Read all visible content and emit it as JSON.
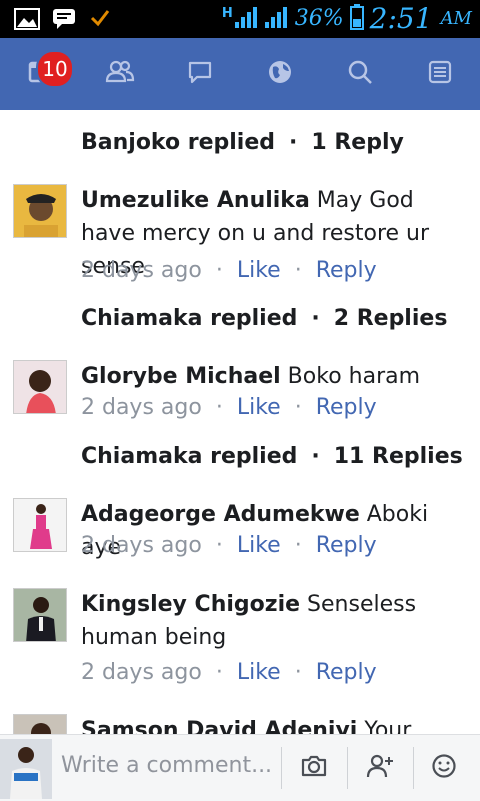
{
  "status_bar": {
    "battery_percent": "36%",
    "time": "2:51",
    "ampm": "AM",
    "network": "H"
  },
  "nav": {
    "notifications_badge": "10",
    "items": [
      "news-feed",
      "friends",
      "messages",
      "notifications",
      "search",
      "menu"
    ]
  },
  "feed": {
    "threads": [
      {
        "replied": "Banjoko replied",
        "replies": "1 Reply"
      }
    ],
    "comments": [
      {
        "author": "Umezulike Anulika",
        "text": " May God have mercy on u and restore ur sense",
        "time": "2 days ago",
        "like": "Like",
        "reply": "Reply",
        "replied": "Chiamaka replied",
        "replies": "2 Replies"
      },
      {
        "author": "Glorybe Michael",
        "text": " Boko haram",
        "time": "2 days ago",
        "like": "Like",
        "reply": "Reply",
        "replied": "Chiamaka replied",
        "replies": "11 Replies"
      },
      {
        "author": "Adageorge Adumekwe",
        "text": " Aboki aye",
        "time": "2 days ago",
        "like": "Like",
        "reply": "Reply"
      },
      {
        "author": "Kingsley Chigozie",
        "text": " Senseless human being",
        "time": "2 days ago",
        "like": "Like",
        "reply": "Reply"
      },
      {
        "author": "Samson David Adeniyi",
        "text": " Your"
      }
    ]
  },
  "composer": {
    "placeholder": "Write a comment..."
  }
}
